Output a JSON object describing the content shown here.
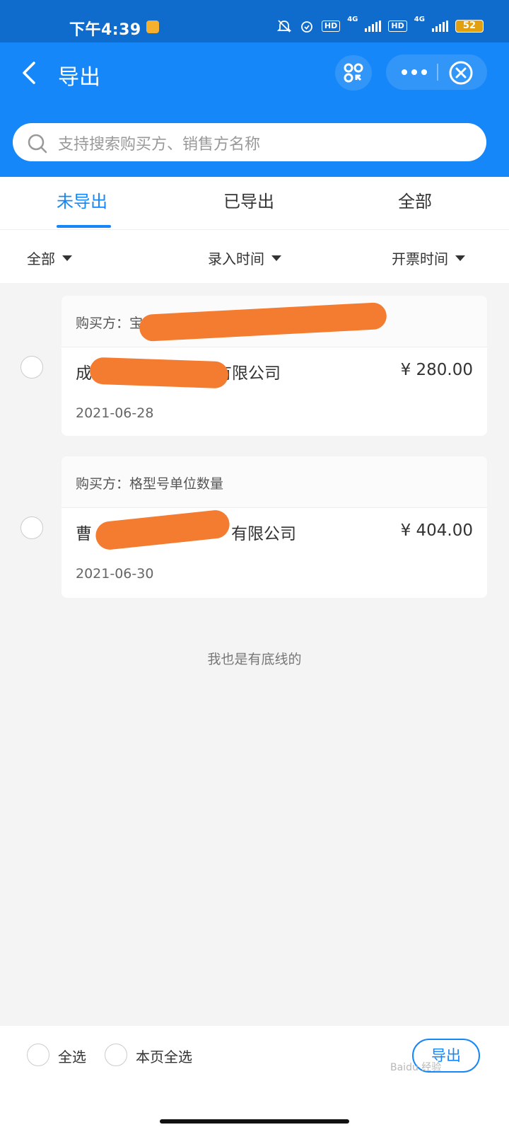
{
  "status_bar": {
    "time": "下午4:39",
    "network1": "4G",
    "network2": "4G",
    "battery": "52",
    "hd": "HD"
  },
  "nav": {
    "title": "导出"
  },
  "search": {
    "placeholder": "支持搜索购买方、销售方名称"
  },
  "tabs": [
    {
      "label": "未导出",
      "active": true
    },
    {
      "label": "已导出",
      "active": false
    },
    {
      "label": "全部",
      "active": false
    }
  ],
  "filters": [
    {
      "label": "全部"
    },
    {
      "label": "录入时间"
    },
    {
      "label": "开票时间"
    }
  ],
  "invoices": [
    {
      "buyer": "购买方：宝",
      "seller_prefix": "成都",
      "seller_suffix": "有限公司",
      "amount": "¥ 280.00",
      "date": "2021-06-28"
    },
    {
      "buyer": "购买方：格型号单位数量",
      "seller_prefix": "曹",
      "seller_suffix": "有限公司",
      "amount": "¥ 404.00",
      "date": "2021-06-30"
    }
  ],
  "end_text": "我也是有底线的",
  "footer": {
    "select_all": "全选",
    "select_page": "本页全选",
    "export": "导出"
  },
  "watermark": "Baidu 经验",
  "colors": {
    "primary": "#1687f8",
    "redaction": "#f47c30"
  }
}
